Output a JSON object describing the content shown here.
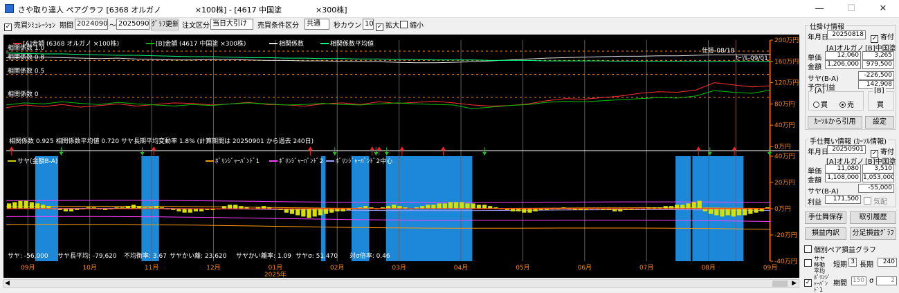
{
  "window": {
    "title": "さや取り達人 ペアグラフ [6368 オルガノ              ×100株] - [4617 中国塗              ×300株]",
    "minimize": "—",
    "maximize": "☐",
    "close": "✕"
  },
  "toolbar": {
    "sim_label": "売買ｼﾐｭﾚｰｼｮﾝ",
    "sim_checked": true,
    "period_label": "期間",
    "period_from": "20240901",
    "tilde": "～",
    "period_to": "20250901",
    "update_button": "ｸﾞﾗﾌ更新",
    "order_type_label": "注文区分",
    "order_type_value": "当日大引け",
    "condition_label": "売買条件区分",
    "condition_value": "共通",
    "seconds_label": "秒カウント",
    "seconds_value": "10",
    "zoom_in_label": "拡大",
    "zoom_in_checked": true,
    "zoom_out_label": "縮小",
    "zoom_out_checked": false
  },
  "chart_data": [
    {
      "type": "line",
      "panel": "upper",
      "legend": [
        "[A]金額 (6368 オルガノ      ×100株)",
        "[B]金額 (4617 中国塗      ×300株)",
        "相関係数",
        "相関係数平均値"
      ],
      "series_colors": [
        "#ff3030",
        "#00c000",
        "#e0e0e0",
        "#00ff80"
      ],
      "left_axis_labels": [
        "相関係数 1.0",
        "相関係数 0.8",
        "相関係数 0.5",
        "相関係数 0"
      ],
      "right_axis_labels": [
        "200万円",
        "160万円",
        "120万円",
        "80万円",
        "40万円",
        "0万円"
      ],
      "right_axis_values": [
        200,
        160,
        120,
        80,
        40,
        0
      ],
      "ylim_manyen": [
        0,
        200
      ],
      "correlation_levels": [
        1.0,
        0.8,
        0.5,
        0
      ],
      "cursor_labels": [
        "仕掛-08/18",
        "ｶｰｿﾙ-09/01"
      ],
      "stats_text": "相関係数 0.925 相関係数平均値 0.720 サヤ長期平均変動率 1.8% (計算期間は 20250901 から過去 240日)",
      "series": [
        {
          "name": "[A]金額 (6368 オルガノ      ×100株)",
          "color": "#ff3030",
          "values_manyen": [
            73,
            78,
            75,
            79,
            74,
            77,
            80,
            76,
            79,
            82,
            81,
            78,
            80,
            83,
            79,
            78,
            76,
            80,
            82,
            79,
            84,
            81,
            83,
            85,
            82,
            78,
            76,
            77,
            80,
            86,
            90,
            89,
            92,
            95,
            100,
            103,
            102,
            106,
            120,
            116,
            112,
            114
          ]
        },
        {
          "name": "[B]金額 (4617 中国塗      ×300株)",
          "color": "#00c000",
          "values_manyen": [
            78,
            82,
            80,
            84,
            81,
            79,
            83,
            80,
            78,
            76,
            79,
            77,
            80,
            82,
            80,
            78,
            79,
            81,
            79,
            78,
            80,
            82,
            80,
            79,
            78,
            71,
            74,
            77,
            79,
            83,
            85,
            84,
            86,
            88,
            90,
            92,
            91,
            95,
            105,
            102,
            100,
            106
          ]
        },
        {
          "name": "相関係数",
          "color": "#e0e0e0",
          "values": [
            0.86,
            0.87,
            0.87,
            0.86,
            0.85,
            0.84,
            0.85,
            0.83,
            0.82,
            0.81,
            0.81,
            0.82,
            0.82,
            0.81,
            0.8,
            0.8,
            0.79,
            0.79,
            0.78,
            0.77,
            0.77,
            0.76,
            0.75,
            0.75,
            0.76,
            0.77,
            0.79,
            0.81,
            0.83,
            0.85,
            0.86,
            0.87,
            0.88,
            0.89,
            0.89,
            0.9,
            0.9,
            0.91,
            0.92,
            0.92,
            0.92,
            0.93
          ]
        },
        {
          "name": "相関係数平均値",
          "color": "#00ff80",
          "values": [
            0.96,
            0.95,
            0.94,
            0.94,
            0.93,
            0.92,
            0.91,
            0.91,
            0.9,
            0.89,
            0.88,
            0.88,
            0.87,
            0.86,
            0.86,
            0.85,
            0.85,
            0.84,
            0.84,
            0.83,
            0.83,
            0.82,
            0.82,
            0.81,
            0.81,
            0.81,
            0.8,
            0.8,
            0.8,
            0.79,
            0.79,
            0.79,
            0.79,
            0.78,
            0.78,
            0.78,
            0.78,
            0.77,
            0.77,
            0.77,
            0.77,
            0.77
          ]
        }
      ]
    },
    {
      "type": "bar",
      "panel": "lower",
      "legend": [
        "サヤ(金額B-A)",
        "ﾎﾞﾘﾝｼﾞｬｰﾊﾞﾝﾄﾞ1",
        "ﾎﾞﾘﾝｼﾞｬｰﾊﾞﾝﾄﾞ2",
        "ﾎﾞﾘﾝｼﾞｬｰﾊﾞﾝﾄﾞ2中心"
      ],
      "legend_colors": [
        "#d0d000",
        "#ff9900",
        "#ff40ff",
        "#a0a0ff"
      ],
      "right_axis_labels": [
        "40万円",
        "20万円",
        "0万円",
        "-20万円",
        "-40万円"
      ],
      "right_axis_values": [
        40,
        20,
        0,
        -20,
        -40
      ],
      "ylim_manyen": [
        -40,
        40
      ],
      "x_labels": [
        "09月",
        "10月",
        "11月",
        "12月",
        "01月",
        "02月",
        "03月",
        "04月",
        "05月",
        "06月",
        "07月",
        "08月",
        "09月"
      ],
      "year_label": "2025年",
      "highlight_ranges": [
        [
          0.038,
          0.068
        ],
        [
          0.177,
          0.2
        ],
        [
          0.412,
          0.418
        ],
        [
          0.452,
          0.475
        ],
        [
          0.497,
          0.61
        ],
        [
          0.876,
          0.896
        ],
        [
          0.898,
          0.965
        ]
      ],
      "series": [
        {
          "name": "サヤ(金額B-A)",
          "values_manyen": [
            4,
            5,
            6,
            6,
            5,
            4,
            3,
            2,
            0,
            -1,
            -2,
            -2,
            -1,
            0,
            1,
            1,
            0,
            -1,
            0,
            1,
            1,
            2,
            3,
            2,
            1,
            1,
            2,
            1,
            0,
            -1,
            -2,
            -3,
            -3,
            -2,
            -2,
            -1,
            -1,
            0,
            2,
            3,
            3,
            2,
            1,
            0,
            1,
            2,
            1,
            0,
            -1,
            -3,
            -4,
            -5,
            -6,
            -7,
            -6,
            -5,
            -4,
            -3,
            -2,
            -2,
            -1,
            0,
            1,
            2,
            1,
            0,
            1,
            2,
            3,
            2,
            1,
            0,
            1,
            2,
            3,
            3,
            4,
            4,
            5,
            5,
            5,
            4,
            4,
            3,
            3,
            2,
            1,
            0,
            -1,
            -2,
            -2,
            -3,
            -3,
            -2,
            -1,
            -1,
            0,
            0,
            1,
            0,
            -1,
            -1,
            -1,
            0,
            0,
            -1,
            -1,
            -2,
            -2,
            -1,
            -1,
            0,
            0,
            1,
            1,
            1,
            2,
            2,
            3,
            3,
            4,
            5,
            6,
            -2,
            -4,
            -5,
            -6,
            -5,
            -6,
            -5,
            -5,
            -4,
            -3,
            -2,
            1
          ]
        }
      ],
      "buy_markers_pct": [
        0.007,
        0.193,
        0.398,
        0.479,
        0.488,
        0.518,
        0.572,
        0.906,
        0.953
      ],
      "sell_markers_pct": [
        0.072,
        0.178,
        0.43,
        0.484,
        0.498,
        0.626,
        0.921,
        0.999
      ],
      "stats": [
        "サヤ: -56,000",
        "サヤ長平均: -79,620",
        "不均衡率: 3.67",
        "サヤかい離: 23,620",
        "サヤかい離率: 1.09",
        "サヤσ: 51,470",
        "対σ倍率: 0.46"
      ]
    }
  ],
  "side": {
    "entry_group_title": "仕掛け情報",
    "entry_date_label": "年月日",
    "entry_date": "20250818",
    "entry_yori_label": "寄付",
    "entry_yori_checked": true,
    "col_a": "[A]オルガノ",
    "col_b": "[B]中国塗",
    "unit_price_label": "単価",
    "unit_price_a": "12,060",
    "unit_price_b": "3,265",
    "amount_label": "金額",
    "amount_a": "1,206,000",
    "amount_b": "979,500",
    "saya_label": "サヤ(B-A)",
    "saya_value": "-226,500",
    "expected_profit_label": "予定利益",
    "expected_profit_value": "142,908",
    "a_side_label": "[A]",
    "b_side_label": "[B]",
    "buy_label": "買",
    "sell_label": "売",
    "a_selected": "sell",
    "b_side_value": "買",
    "cursor_quote_button": "ｶｰｿﾙから引用",
    "settings_button": "設定",
    "exit_group_title": "手仕舞い情報 (ｶｰｿﾙ情報)",
    "exit_date_label": "年月日",
    "exit_date": "20250901",
    "exit_yori_label": "寄付",
    "exit_yori_checked": true,
    "exit_unit_price_a": "11,080",
    "exit_unit_price_b": "3,510",
    "exit_amount_label": "金額",
    "exit_amount_a": "1,108,000",
    "exit_amount_b": "1,053,000",
    "exit_saya_value": "-55,000",
    "profit_label": "利益",
    "profit_value": "171,500",
    "dividend_label": "気配",
    "exit_save_button": "手仕舞保存",
    "history_button": "取引履歴",
    "profit_detail_button": "損益内訳",
    "split_graph_button": "分足損益ｸﾞﾗﾌ",
    "pair_graph_label": "個別ペア損益グラフ",
    "pair_graph_checked": false,
    "ma_label": "サヤ移動平均",
    "ma_checked": false,
    "short_label": "短期",
    "short_value": "3",
    "long_label": "長期",
    "long_value": "240",
    "bb_label": "ﾎﾞﾘﾝｼﾞｬｰﾊﾞﾝﾄﾞ1",
    "bb_checked": true,
    "bb_period_label": "期間",
    "bb_period_value": "150",
    "sigma_label": "σ",
    "sigma_value": "2"
  },
  "colors": {
    "chart_bg": "#000000",
    "axis_text": "#ff8800",
    "highlight": "#1e88d8",
    "saya_bar": "#d8e000",
    "window_bg": "#f0f0f0"
  }
}
